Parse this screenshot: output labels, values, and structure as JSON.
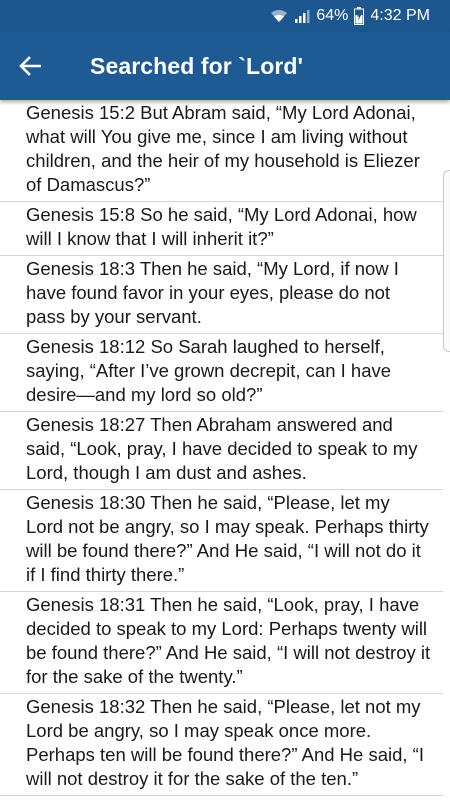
{
  "status_bar": {
    "battery": "64%",
    "time": "4:32 PM",
    "wifi_icon": "wifi-icon",
    "signal_icon": "signal-icon",
    "battery_icon": "battery-charging-icon"
  },
  "app_bar": {
    "title": "Searched for `Lord'",
    "back_icon": "arrow-left-icon",
    "color": "#1e5a94"
  },
  "results": [
    {
      "text": "Genesis 15:2 But Abram said, “My Lord Adonai, what will You give me, since I am living without children, and the heir of my household is Eliezer of Damascus?”"
    },
    {
      "text": "Genesis 15:8 So he said, “My Lord Adonai, how will I know that I will inherit it?”"
    },
    {
      "text": "Genesis 18:3 Then he said, “My Lord, if now I have found favor in your eyes, please do not pass by your servant."
    },
    {
      "text": "Genesis 18:12 So Sarah laughed to herself, saying, “After I’ve grown decrepit, can I have desire—and my lord so old?”"
    },
    {
      "text": "Genesis 18:27 Then Abraham answered and said, “Look, pray, I have decided to speak to my Lord, though I am dust and ashes."
    },
    {
      "text": "Genesis 18:30 Then he said, “Please, let my Lord not be angry, so I may speak. Perhaps thirty will be found there?” And He said, “I will not do it if I find thirty there.”"
    },
    {
      "text": "Genesis 18:31 Then he said, “Look, pray, I have decided to speak to my Lord: Perhaps twenty will be found there?” And He said, “I will not destroy it for the sake of the twenty.”"
    },
    {
      "text": "Genesis 18:32 Then he said, “Please, let not my Lord be angry, so I may speak once more. Perhaps ten will be found there?” And He said, “I will not destroy it for the sake of the ten.”"
    }
  ]
}
